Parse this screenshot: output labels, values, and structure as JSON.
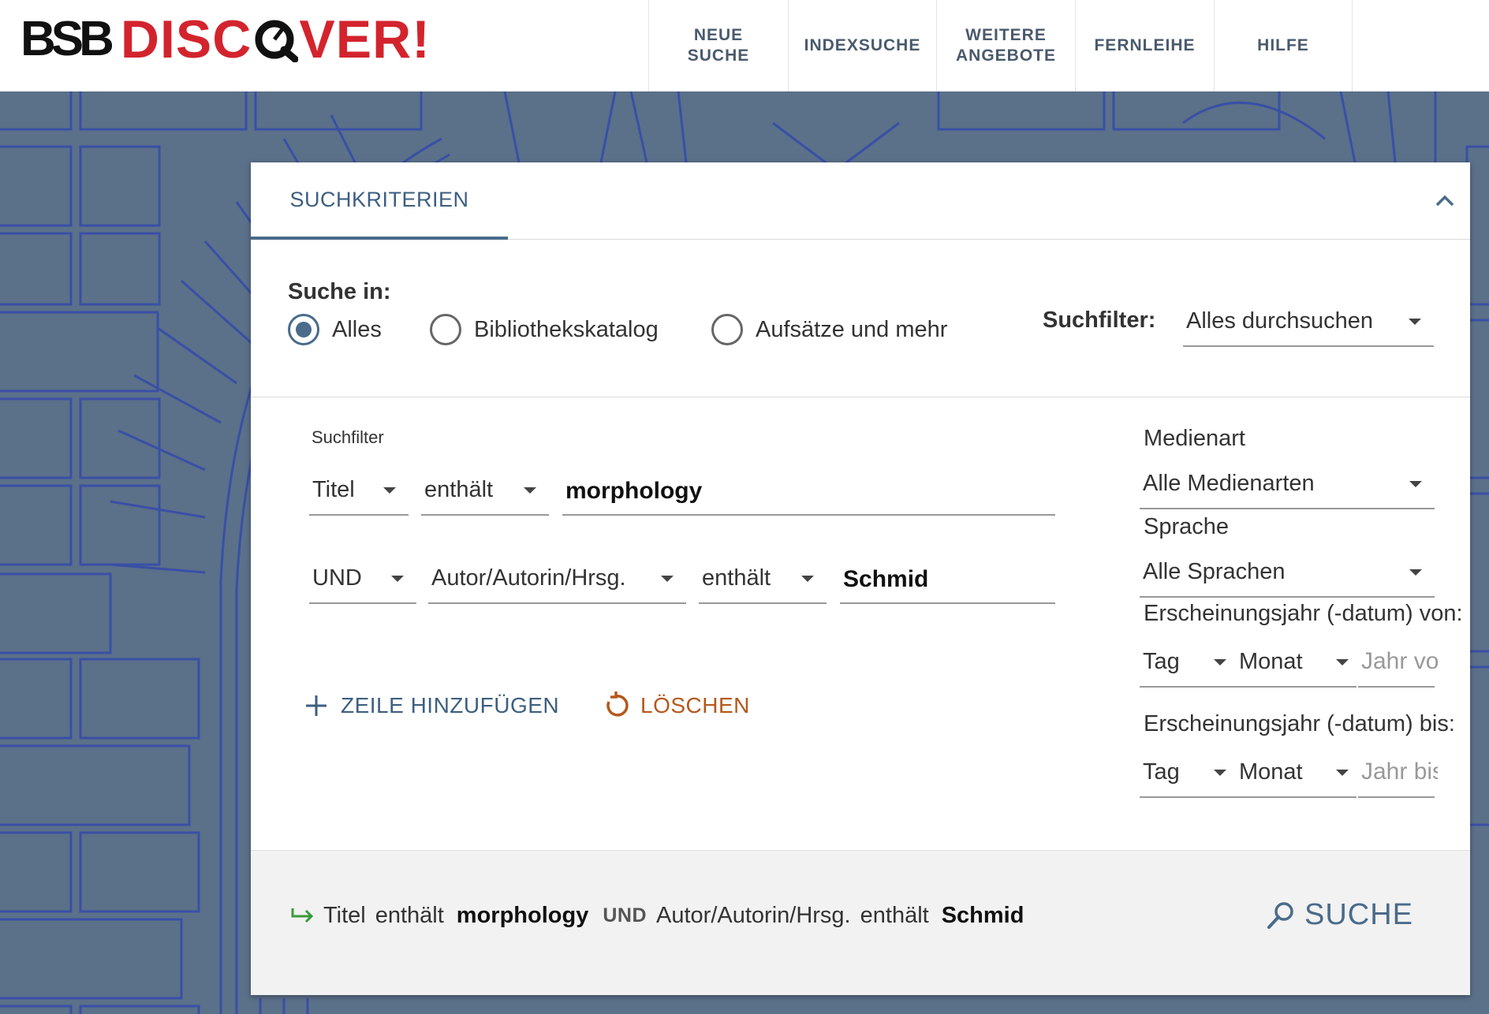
{
  "logo": {
    "bsb": "BSB",
    "discover_pre": "DISC",
    "discover_post": "VER!"
  },
  "nav": [
    {
      "label_line1": "NEUE",
      "label_line2": "SUCHE"
    },
    {
      "label_line1": "INDEXSUCHE",
      "label_line2": ""
    },
    {
      "label_line1": "WEITERE",
      "label_line2": "ANGEBOTE"
    },
    {
      "label_line1": "FERNLEIHE",
      "label_line2": ""
    },
    {
      "label_line1": "HILFE",
      "label_line2": ""
    }
  ],
  "panel": {
    "tab_label": "SUCHKRITERIEN",
    "search_in_label": "Suche in:",
    "scope_options": [
      {
        "label": "Alles",
        "selected": true
      },
      {
        "label": "Bibliothekskatalog",
        "selected": false
      },
      {
        "label": "Aufsätze und mehr",
        "selected": false
      }
    ],
    "filter_label": "Suchfilter:",
    "filter_value": "Alles durchsuchen",
    "rows_label": "Suchfilter",
    "row1": {
      "field": "Titel",
      "operator": "enthält",
      "value": "morphology"
    },
    "row2": {
      "bool": "UND",
      "field": "Autor/Autorin/Hrsg.",
      "operator": "enthält",
      "value": "Schmid"
    },
    "add_row_label": "ZEILE HINZUFÜGEN",
    "clear_label": "LÖSCHEN",
    "media_label": "Medienart",
    "media_value": "Alle Medienarten",
    "language_label": "Sprache",
    "language_value": "Alle Sprachen",
    "year_from_label": "Erscheinungsjahr (-datum) von:",
    "year_from": {
      "day": "Tag",
      "month": "Monat",
      "year_placeholder": "Jahr von"
    },
    "year_to_label": "Erscheinungsjahr (-datum) bis:",
    "year_to": {
      "day": "Tag",
      "month": "Monat",
      "year_placeholder": "Jahr bis"
    },
    "summary": {
      "field1": "Titel",
      "op1": "enthält",
      "value1": "morphology",
      "bool": "UND",
      "field2": "Autor/Autorin/Hrsg.",
      "op2": "enthält",
      "value2": "Schmid"
    },
    "search_button": "SUCHE"
  },
  "colors": {
    "accent": "#4a6b8a",
    "brand_red": "#d3242e",
    "background": "#5b7089",
    "clear_orange": "#b5581c",
    "arrow_green": "#3a9a3a"
  }
}
